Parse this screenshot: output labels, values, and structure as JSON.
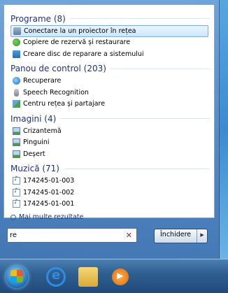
{
  "sections": [
    {
      "title": "Programe (8)",
      "items": [
        {
          "label": "Conectare la un proiector în rețea",
          "icon": "projector-icon"
        },
        {
          "label": "Copiere de rezervă și restaurare",
          "icon": "backup-icon"
        },
        {
          "label": "Creare disc de reparare a sistemului",
          "icon": "disc-icon"
        }
      ]
    },
    {
      "title": "Panou de control (203)",
      "items": [
        {
          "label": "Recuperare",
          "icon": "recovery-icon"
        },
        {
          "label": "Speech Recognition",
          "icon": "microphone-icon"
        },
        {
          "label": "Centru rețea și partajare",
          "icon": "network-icon"
        }
      ]
    },
    {
      "title": "Imagini (4)",
      "items": [
        {
          "label": "Crizantemă",
          "icon": "image-icon"
        },
        {
          "label": "Pinguini",
          "icon": "image-icon"
        },
        {
          "label": "Deșert",
          "icon": "image-icon"
        }
      ]
    },
    {
      "title": "Muzică (71)",
      "items": [
        {
          "label": "174245-01-003",
          "icon": "music-file-icon"
        },
        {
          "label": "174245-01-002",
          "icon": "music-file-icon"
        },
        {
          "label": "174245-01-001",
          "icon": "music-file-icon"
        }
      ]
    }
  ],
  "more_results": "Mai multe rezultate",
  "search": {
    "value": "re"
  },
  "shutdown_label": "Închidere"
}
